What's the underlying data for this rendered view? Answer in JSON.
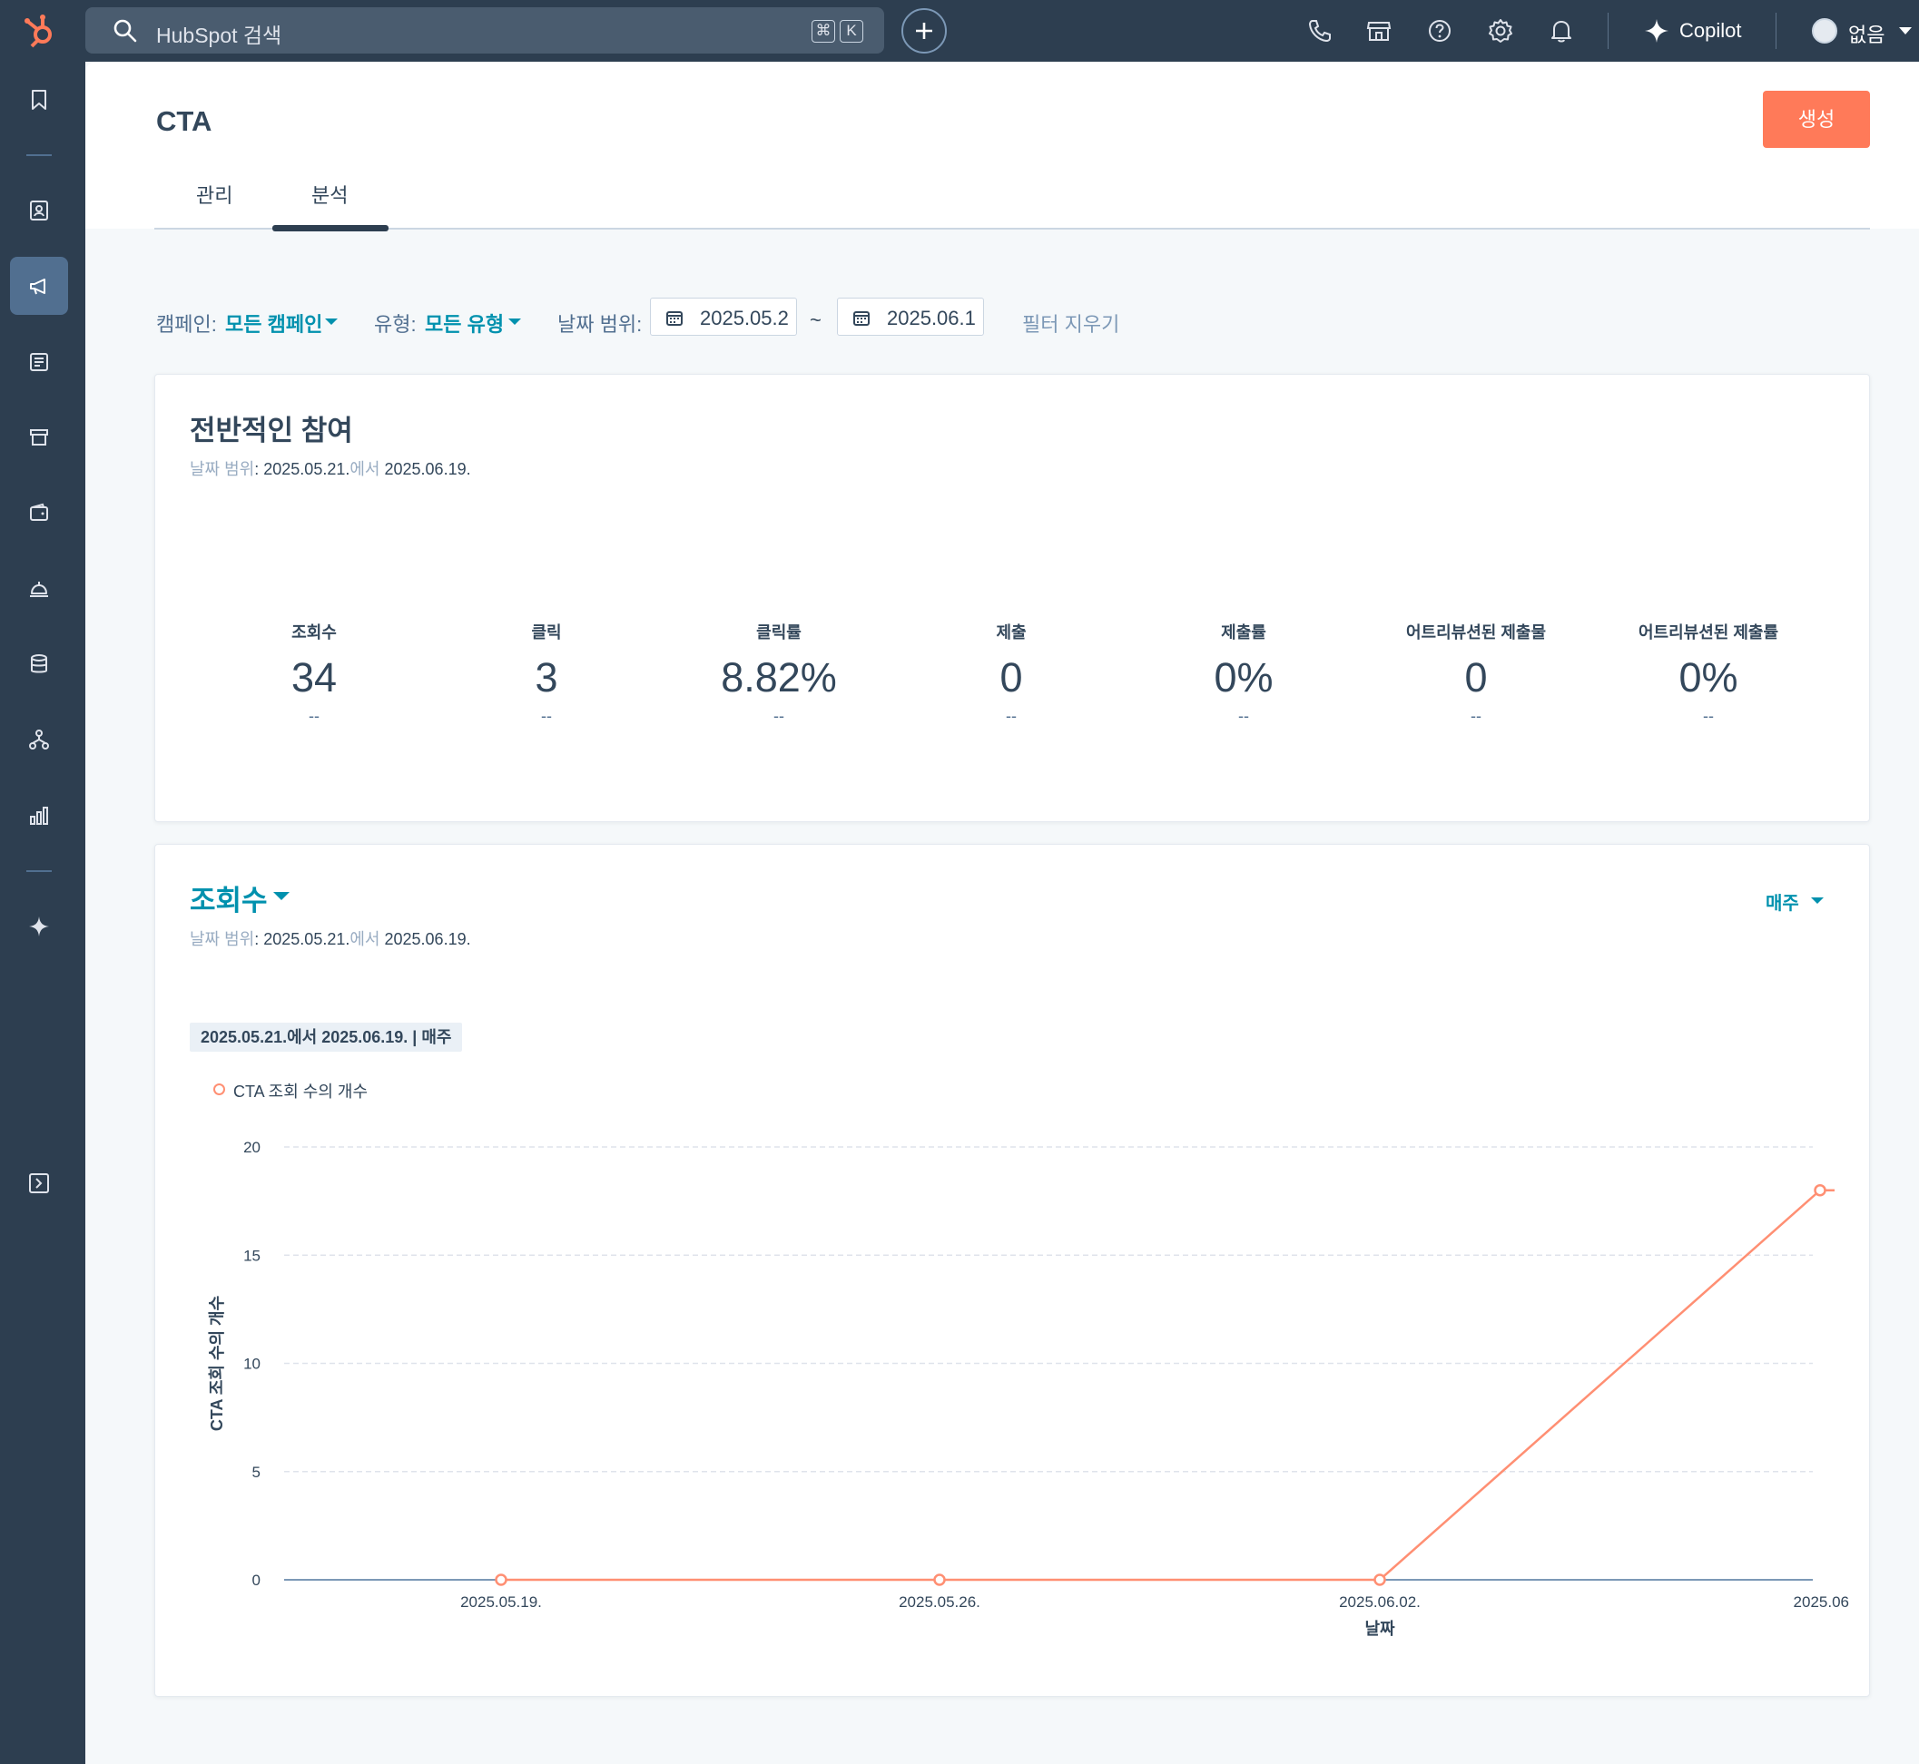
{
  "topbar": {
    "search_placeholder": "HubSpot 검색",
    "kbd_cmd": "⌘",
    "kbd_k": "K",
    "copilot_label": "Copilot",
    "user_name": "없음"
  },
  "page": {
    "title": "CTA",
    "create_label": "생성",
    "tabs": [
      {
        "label": "관리",
        "active": false
      },
      {
        "label": "분석",
        "active": true
      }
    ]
  },
  "filters": {
    "campaign_label": "캠페인:",
    "campaign_value": "모든 캠페인",
    "type_label": "유형:",
    "type_value": "모든 유형",
    "date_label": "날짜 범위:",
    "date_start": "2025.05.2",
    "date_sep": "~",
    "date_end": "2025.06.1",
    "clear_label": "필터 지우기"
  },
  "engagement": {
    "title": "전반적인 참여",
    "range_label": "날짜 범위",
    "range_start": "2025.05.21.",
    "range_mid": "에서",
    "range_end": "2025.06.19.",
    "metrics": [
      {
        "label": "조회수",
        "value": "34",
        "delta": "--"
      },
      {
        "label": "클릭",
        "value": "3",
        "delta": "--"
      },
      {
        "label": "클릭률",
        "value": "8.82%",
        "delta": "--"
      },
      {
        "label": "제출",
        "value": "0",
        "delta": "--"
      },
      {
        "label": "제출률",
        "value": "0%",
        "delta": "--"
      },
      {
        "label": "어트리뷰션된 제출물",
        "value": "0",
        "delta": "--"
      },
      {
        "label": "어트리뷰션된 제출률",
        "value": "0%",
        "delta": "--"
      }
    ]
  },
  "views_card": {
    "title": "조회수",
    "frequency": "매주",
    "range_label": "날짜 범위",
    "range_start": "2025.05.21.",
    "range_mid": "에서",
    "range_end": "2025.06.19.",
    "range_tag": "2025.05.21.에서 2025.06.19. | 매주",
    "legend": "CTA 조회 수의 개수"
  },
  "chart_data": {
    "type": "line",
    "title": "",
    "xlabel": "날짜",
    "ylabel": "CTA 조회 수의 개수",
    "x": [
      "2025.05.19.",
      "2025.05.26.",
      "2025.06.02.",
      "2025.06"
    ],
    "series": [
      {
        "name": "CTA 조회 수의 개수",
        "values": [
          0,
          0,
          0,
          18
        ],
        "color": "#ff8f73"
      }
    ],
    "yticks": [
      0,
      5,
      10,
      15,
      20
    ],
    "ylim": [
      0,
      20
    ],
    "grid": true,
    "legend": "top-left"
  },
  "colors": {
    "nav": "#2d3e50",
    "accent": "#ff7a59",
    "link": "#0091ae",
    "line": "#ff8f73"
  }
}
